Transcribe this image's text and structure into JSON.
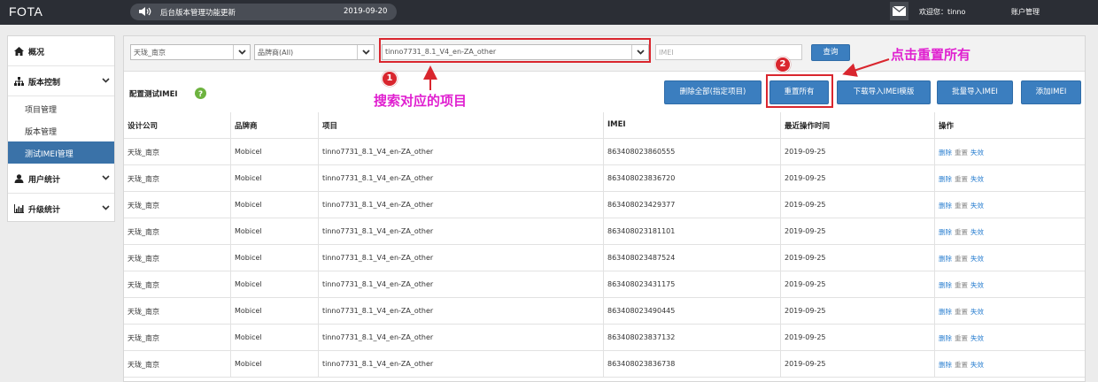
{
  "app": {
    "title": "FOTA"
  },
  "notice": {
    "text": "后台版本管理功能更新",
    "date": "2019-09-20"
  },
  "header": {
    "welcome": "欢迎您：tinno",
    "account": "账户管理"
  },
  "sidebar": {
    "items": [
      {
        "label": "概况",
        "icon": "home-icon"
      },
      {
        "label": "版本控制",
        "icon": "sitemap-icon"
      },
      {
        "label": "用户统计",
        "icon": "user-icon"
      },
      {
        "label": "升级统计",
        "icon": "bar-chart-icon"
      }
    ],
    "sub_items": [
      "项目管理",
      "版本管理",
      "测试IMEI管理"
    ]
  },
  "filters": {
    "company": "天珑_南京",
    "brand": "品牌商(All)",
    "project": "tinno7731_8.1_V4_en-ZA_other",
    "imei_placeholder": "IMEI",
    "query": "查询"
  },
  "section": {
    "title": "配置测试IMEI"
  },
  "actions": {
    "delete_all": "删除全部(指定项目)",
    "reset_all": "重置所有",
    "download_template": "下载导入IMEI模版",
    "batch_import": "批量导入IMEI",
    "add": "添加IMEI"
  },
  "table": {
    "headers": [
      "设计公司",
      "品牌商",
      "项目",
      "IMEI",
      "最近操作时间",
      "操作"
    ],
    "ops": [
      "删除",
      "重置",
      "失效"
    ],
    "rows": [
      [
        "天珑_南京",
        "Mobicel",
        "tinno7731_8.1_V4_en-ZA_other",
        "863408023860555",
        "2019-09-25"
      ],
      [
        "天珑_南京",
        "Mobicel",
        "tinno7731_8.1_V4_en-ZA_other",
        "863408023836720",
        "2019-09-25"
      ],
      [
        "天珑_南京",
        "Mobicel",
        "tinno7731_8.1_V4_en-ZA_other",
        "863408023429377",
        "2019-09-25"
      ],
      [
        "天珑_南京",
        "Mobicel",
        "tinno7731_8.1_V4_en-ZA_other",
        "863408023181101",
        "2019-09-25"
      ],
      [
        "天珑_南京",
        "Mobicel",
        "tinno7731_8.1_V4_en-ZA_other",
        "863408023487524",
        "2019-09-25"
      ],
      [
        "天珑_南京",
        "Mobicel",
        "tinno7731_8.1_V4_en-ZA_other",
        "863408023431175",
        "2019-09-25"
      ],
      [
        "天珑_南京",
        "Mobicel",
        "tinno7731_8.1_V4_en-ZA_other",
        "863408023490445",
        "2019-09-25"
      ],
      [
        "天珑_南京",
        "Mobicel",
        "tinno7731_8.1_V4_en-ZA_other",
        "863408023837132",
        "2019-09-25"
      ],
      [
        "天珑_南京",
        "Mobicel",
        "tinno7731_8.1_V4_en-ZA_other",
        "863408023836738",
        "2019-09-25"
      ]
    ]
  },
  "annotations": {
    "badge1": "1",
    "badge2": "2",
    "text1": "搜索对应的项目",
    "text2": "点击重置所有",
    "color": "#e020d0",
    "box_color": "#d9262e"
  },
  "colors": {
    "topbar": "#2b2e35",
    "primary": "#3b7ebf",
    "sidebar_active": "#3a72a8",
    "link": "#2a7fd0"
  }
}
